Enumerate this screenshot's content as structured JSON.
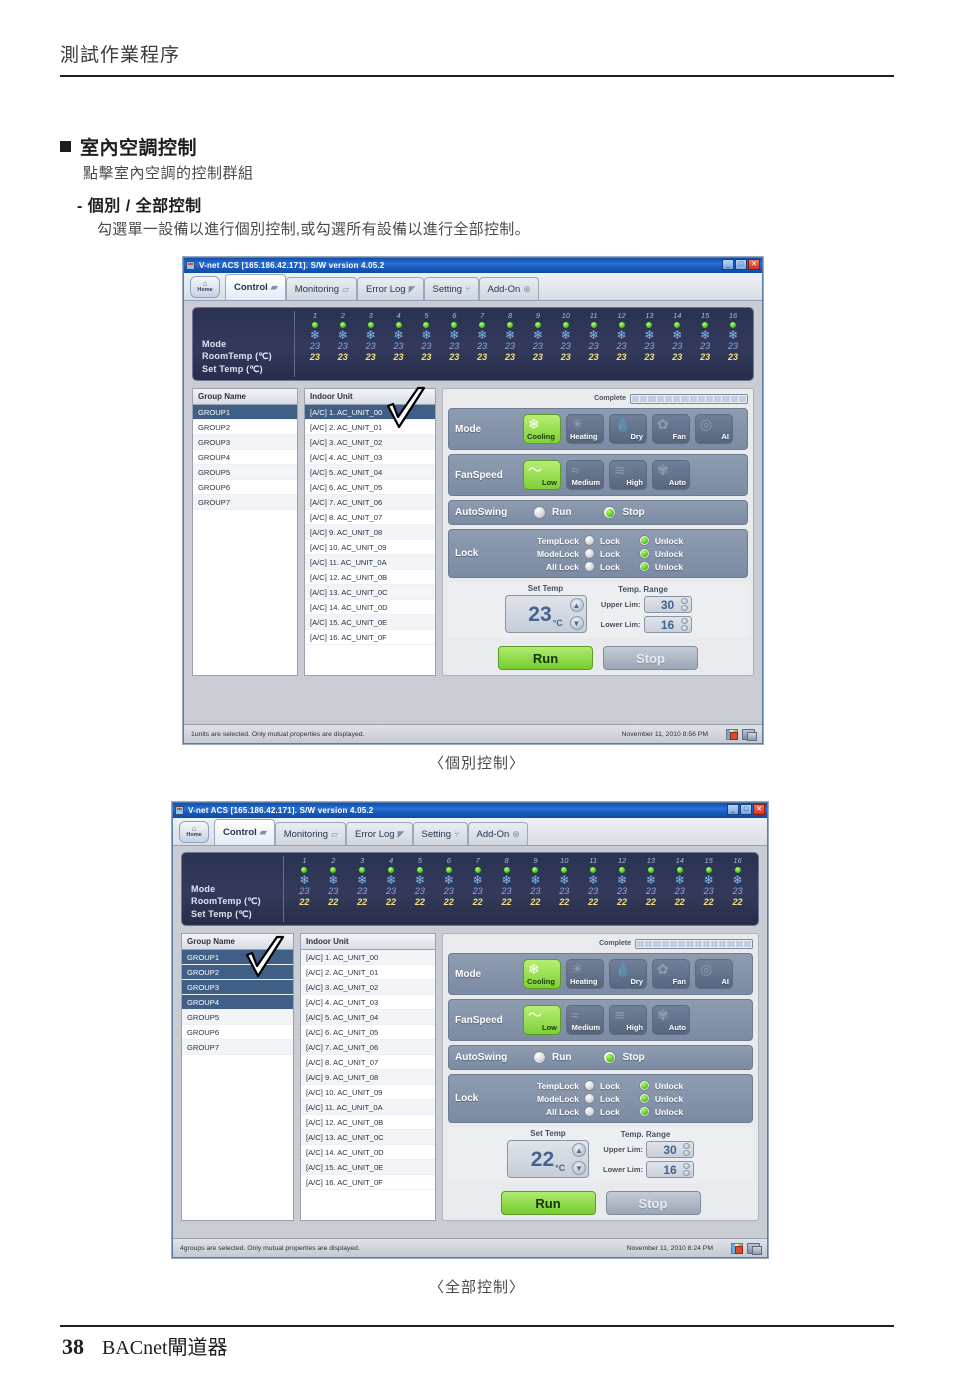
{
  "page": {
    "running_head": "測試作業程序",
    "section_title": "室內空調控制",
    "section_sub": "點擊室內空調的控制群組",
    "section_sub2": "- 個別 / 全部控制",
    "section_sub3": "勾選單一設備以進行個別控制,或勾選所有設備以進行全部控制。",
    "caption1": "〈個別控制〉",
    "caption2": "〈全部控制〉",
    "page_number": "38",
    "footer_text": "BACnet閘道器"
  },
  "app": {
    "window_title": "V-net ACS [165.186.42.171].   S/W version 4.05.2",
    "home_label": "Home",
    "min_label": "_",
    "max_label": "□",
    "close_label": "✕",
    "tabs": [
      {
        "label": "Control",
        "icon": "control-icon",
        "active": true
      },
      {
        "label": "Monitoring",
        "icon": "monitor-icon",
        "active": false
      },
      {
        "label": "Error Log",
        "icon": "errorlog-icon",
        "active": false
      },
      {
        "label": "Setting",
        "icon": "tools-icon",
        "active": false
      },
      {
        "label": "Add-On",
        "icon": "plus-circle-icon",
        "active": false
      }
    ],
    "strip": {
      "row_labels": [
        "Mode",
        "RoomTemp (℃)",
        "Set Temp  (℃)"
      ],
      "indices": [
        "1",
        "2",
        "3",
        "4",
        "5",
        "6",
        "7",
        "8",
        "9",
        "10",
        "11",
        "12",
        "13",
        "14",
        "15",
        "16"
      ],
      "mode_glyph": "❄"
    },
    "list_headers": {
      "group": "Group Name",
      "unit": "Indoor Unit"
    },
    "groups": [
      "GROUP1",
      "GROUP2",
      "GROUP3",
      "GROUP4",
      "GROUP5",
      "GROUP6",
      "GROUP7"
    ],
    "units": [
      "[A/C]  1. AC_UNIT_00",
      "[A/C]  2. AC_UNIT_01",
      "[A/C]  3. AC_UNIT_02",
      "[A/C]  4. AC_UNIT_03",
      "[A/C]  5. AC_UNIT_04",
      "[A/C]  6. AC_UNIT_05",
      "[A/C]  7. AC_UNIT_06",
      "[A/C]  8. AC_UNIT_07",
      "[A/C]  9. AC_UNIT_08",
      "[A/C] 10. AC_UNIT_09",
      "[A/C] 11. AC_UNIT_0A",
      "[A/C] 12. AC_UNIT_0B",
      "[A/C] 13. AC_UNIT_0C",
      "[A/C] 14. AC_UNIT_0D",
      "[A/C] 15. AC_UNIT_0E",
      "[A/C] 16. AC_UNIT_0F"
    ],
    "complete_label": "Complete",
    "mode": {
      "label": "Mode",
      "buttons": [
        {
          "label": "Cooling",
          "icon": "snowflake-icon",
          "glyph": "❄",
          "on": true
        },
        {
          "label": "Heating",
          "icon": "sun-icon",
          "glyph": "☀",
          "on": false
        },
        {
          "label": "Dry",
          "icon": "droplet-icon",
          "glyph": "💧",
          "on": false
        },
        {
          "label": "Fan",
          "icon": "fan-icon",
          "glyph": "✿",
          "on": false
        },
        {
          "label": "AI",
          "icon": "ai-icon",
          "glyph": "◎",
          "on": false
        }
      ]
    },
    "fanspeed": {
      "label": "FanSpeed",
      "buttons": [
        {
          "label": "Low",
          "icon": "wave-single-icon",
          "glyph": "〜",
          "on": true
        },
        {
          "label": "Medium",
          "icon": "wave-double-icon",
          "glyph": "≈",
          "on": false
        },
        {
          "label": "High",
          "icon": "wave-triple-icon",
          "glyph": "≋",
          "on": false
        },
        {
          "label": "Auto",
          "icon": "fan-auto-icon",
          "glyph": "✾",
          "on": false
        }
      ]
    },
    "autoswing": {
      "label": "AutoSwing",
      "run_label": "Run",
      "stop_label": "Stop",
      "selected": "Stop"
    },
    "lock": {
      "label": "Lock",
      "lock_text": "Lock",
      "unlock_text": "Unlock",
      "rows": [
        {
          "name": "TempLock",
          "selected": "Unlock"
        },
        {
          "name": "ModeLock",
          "selected": "Unlock"
        },
        {
          "name": "All Lock",
          "selected": "Unlock"
        }
      ]
    },
    "settemp": {
      "label": "Set Temp",
      "unit": "°C",
      "up": "▲",
      "down": "▼"
    },
    "range": {
      "label": "Temp. Range",
      "upper_label": "Upper Lim:",
      "lower_label": "Lower Lim:",
      "upper_value": "30",
      "lower_value": "16"
    },
    "actions": {
      "run": "Run",
      "stop": "Stop"
    }
  },
  "screen1": {
    "room_temp": "23",
    "set_temp_strip": "23",
    "set_temp_value": "23",
    "selected_group": "GROUP1",
    "selected_group_index": 0,
    "selected_unit_index": 0,
    "status_text": "1units are selected. Only mutual properties are displayed.",
    "status_date": "November 11, 2010  8:56 PM"
  },
  "screen2": {
    "room_temp": "23",
    "set_temp_strip": "22",
    "set_temp_value": "22",
    "selected_group_indices": [
      0,
      1,
      2,
      3
    ],
    "selected_unit_index": -1,
    "status_text": "4groups are selected. Only mutual properties are displayed.",
    "status_date": "November 11, 2010  8:24 PM"
  },
  "colors": {
    "accent_green": "#7ed03a",
    "panel_blue": "#7b8ba3",
    "strip_dark": "#2b3150",
    "title_blue": "#1a5cc0",
    "select_blue": "#3f5f86"
  }
}
